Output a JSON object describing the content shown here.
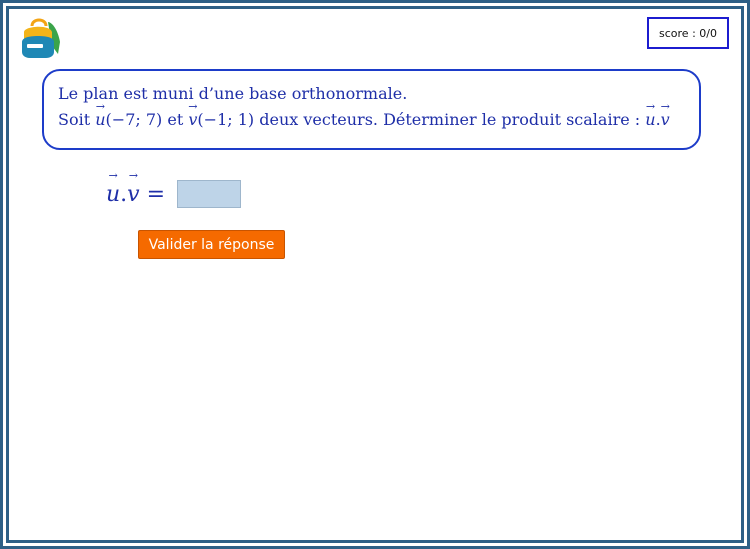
{
  "header": {
    "logo_icon": "backpack-icon",
    "score_label": "score : 0/0"
  },
  "question": {
    "line1": "Le plan est muni d’une base orthonormale.",
    "line2_prefix": "Soit",
    "u_name": "u",
    "u_coords": "(−7; 7)",
    "conj": "et",
    "v_name": "v",
    "v_coords": "(−1; 1)",
    "line2_suffix": "deux vecteurs. Déterminer le produit scalaire :",
    "dot": "."
  },
  "answer": {
    "u_name": "u",
    "dot": ".",
    "v_name": "v",
    "equals": "=",
    "input_value": ""
  },
  "validate_button_label": "Valider la réponse",
  "colors": {
    "frame": "#2d5f86",
    "question_border": "#1d3cc9",
    "text": "#1f2fa8",
    "button": "#f56a00",
    "input": "#bed4e8"
  }
}
